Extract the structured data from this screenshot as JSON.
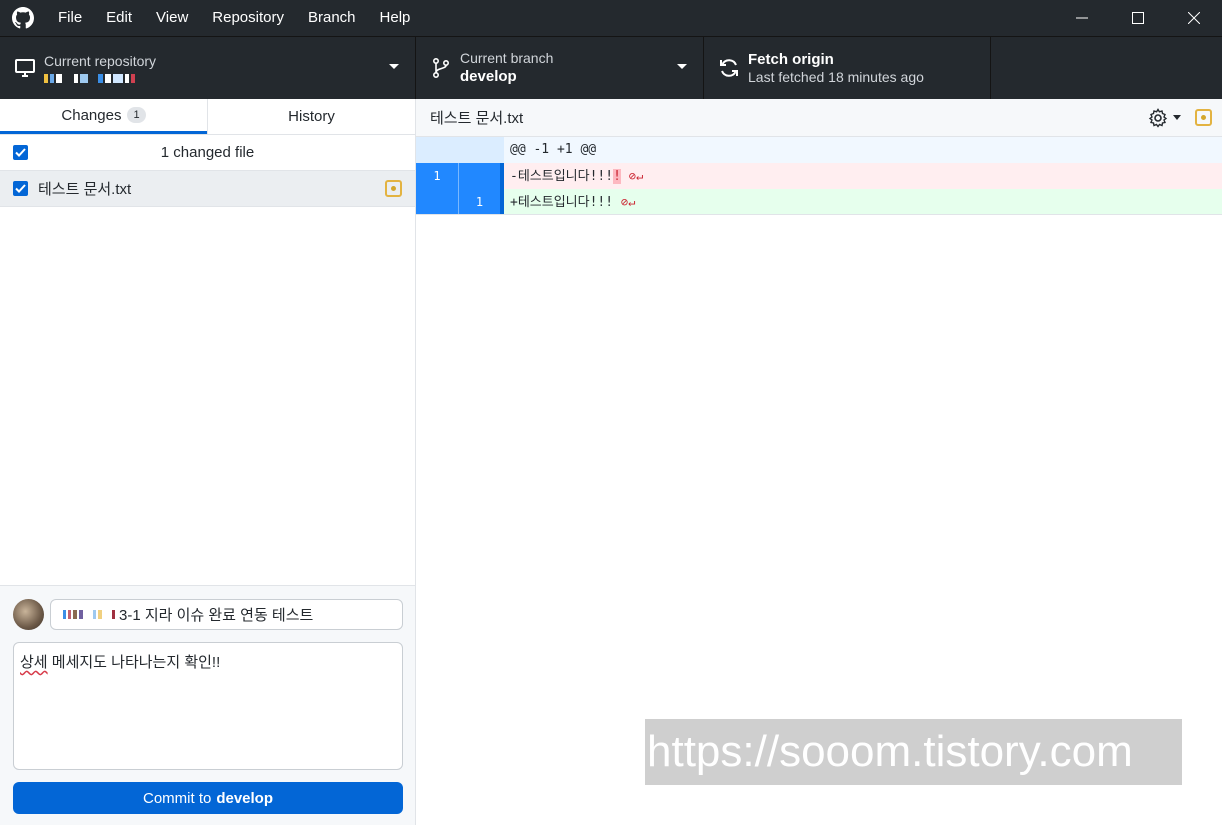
{
  "menu": [
    "File",
    "Edit",
    "View",
    "Repository",
    "Branch",
    "Help"
  ],
  "toolbar": {
    "repo_label": "Current repository",
    "branch_label": "Current branch",
    "branch_name": "develop",
    "fetch_title": "Fetch origin",
    "fetch_status": "Last fetched 18 minutes ago"
  },
  "sidebar": {
    "tab_changes": "Changes",
    "changes_count": "1",
    "tab_history": "History",
    "changed_files_label": "1 changed file",
    "files": [
      {
        "name": "테스트 문서.txt",
        "status": "modified"
      }
    ]
  },
  "commit": {
    "summary_visible": "3-1 지라 이슈 완료 연동 테스트",
    "description_word1": "상세",
    "description_rest": " 메세지도 나타나는지 확인!!",
    "button_prefix": "Commit to",
    "button_branch": "develop"
  },
  "diff": {
    "filename": "테스트 문서.txt",
    "hunk": "@@ -1 +1 @@",
    "lines": [
      {
        "old": "1",
        "new": "",
        "text": "-테스트입니다!!!",
        "highlight": "!"
      },
      {
        "old": "",
        "new": "1",
        "text": "+테스트입니다!!!"
      }
    ]
  },
  "watermark": "https://sooom.tistory.com",
  "colors": {
    "accent": "#0366d6",
    "chrome": "#24292e",
    "modified": "#e3b341"
  }
}
